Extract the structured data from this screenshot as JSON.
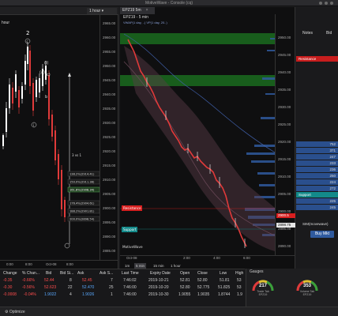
{
  "window": {
    "title": "MotiveWave - Console (cq)"
  },
  "left_chart": {
    "timeframe": "1 hour",
    "symbol_tab": "hour",
    "price_axis": [
      "2965.00",
      "2960.00",
      "2955.00",
      "2950.00",
      "2945.00",
      "2940.00",
      "2935.00",
      "2930.00",
      "2925.00",
      "2920.00",
      "2915.00",
      "2910.00",
      "2905.00",
      "2900.00",
      "2895.00",
      "2890.00",
      "2885.00"
    ],
    "time_axis": [
      "0:00",
      "8:00",
      "Oct-08",
      "8:00"
    ],
    "wave_labels": [
      "2",
      "c",
      "(i)",
      "(a)",
      "(c)",
      "b",
      "i"
    ],
    "fib_labels": [
      "138.2%(2914.41)",
      "150.0%(2911.38)",
      "161.8%(2908.34)",
      "176.4%(2904.61)",
      "188.2%(2901.81)",
      "200.0%(2898.54)"
    ],
    "wave_note": "3 vs 1"
  },
  "right_chart": {
    "tab_label": "EPZ19 5m",
    "title": "EPZ19 - 5 min",
    "legend": "VWAP(1 day, ..)  VP(1 day, 20..)",
    "price_axis": [
      "2950.00",
      "2945.00",
      "2940.00",
      "2935.00",
      "2930.00",
      "2925.00",
      "2920.00",
      "2915.00",
      "2910.00",
      "2905.00",
      "2900.00",
      "2895.00",
      "2890.00"
    ],
    "resistance_label": "Resistance",
    "support_label": "Support",
    "price_tags": [
      "2900.5",
      "2898.75"
    ],
    "time_axis": [
      "Oct-08",
      "2:00",
      "4:00",
      "6:00"
    ],
    "timeframes": [
      "1m",
      "5 min",
      "15 min",
      "1 hour"
    ],
    "footer_label": "MotiveWave"
  },
  "dom": {
    "headers": [
      "Notes",
      "Bid"
    ],
    "resistance_label": "Resistance",
    "support_label": "Support",
    "sizes": [
      "752",
      "371",
      "247",
      "233",
      "236",
      "250",
      "224",
      "272",
      "225",
      "245"
    ],
    "sim_label": "SIM(movewave)",
    "buy_button": "Buy Mkt"
  },
  "quotes": {
    "columns": [
      "Change",
      "% Chan...",
      "Bid",
      "Bid Si...",
      "Ask",
      "Ask S...",
      "Last Time",
      "Expiry Date",
      "Open",
      "Close",
      "Low",
      "High"
    ],
    "rows": [
      [
        "-0.35",
        "-0.66%",
        "52.44",
        "8",
        "52.45",
        "7",
        "7:46:02",
        "2019-10-21",
        "52.81",
        "52.80",
        "51.81",
        "53"
      ],
      [
        "-0.30",
        "-0.56%",
        "52.623",
        "22",
        "52.470",
        "25",
        "7:46:00",
        "2019-10-20",
        "52.80",
        "52.775",
        "51.825",
        "53"
      ],
      [
        "-0.0008",
        "-0.04%",
        "1.9022",
        "4",
        "1.9026",
        "1",
        "7:46:00",
        "2019-10-30",
        "1.9055",
        "1.9035",
        "1.8744",
        "1.9"
      ]
    ]
  },
  "gauges": {
    "tabs": [
      "Gauges"
    ],
    "items": [
      {
        "value": "217",
        "label": "Trade Tab",
        "sub": "EPZ19"
      },
      {
        "value": "353",
        "label": "Volume Tab",
        "sub": "EPZ19"
      }
    ]
  },
  "status": {
    "optimize": "Optimize"
  },
  "colors": {
    "up": "#ffffff",
    "down": "#e03a3a",
    "resistance": "#d81f1f",
    "support": "#138a8a",
    "zone": "#1a6b1f"
  }
}
